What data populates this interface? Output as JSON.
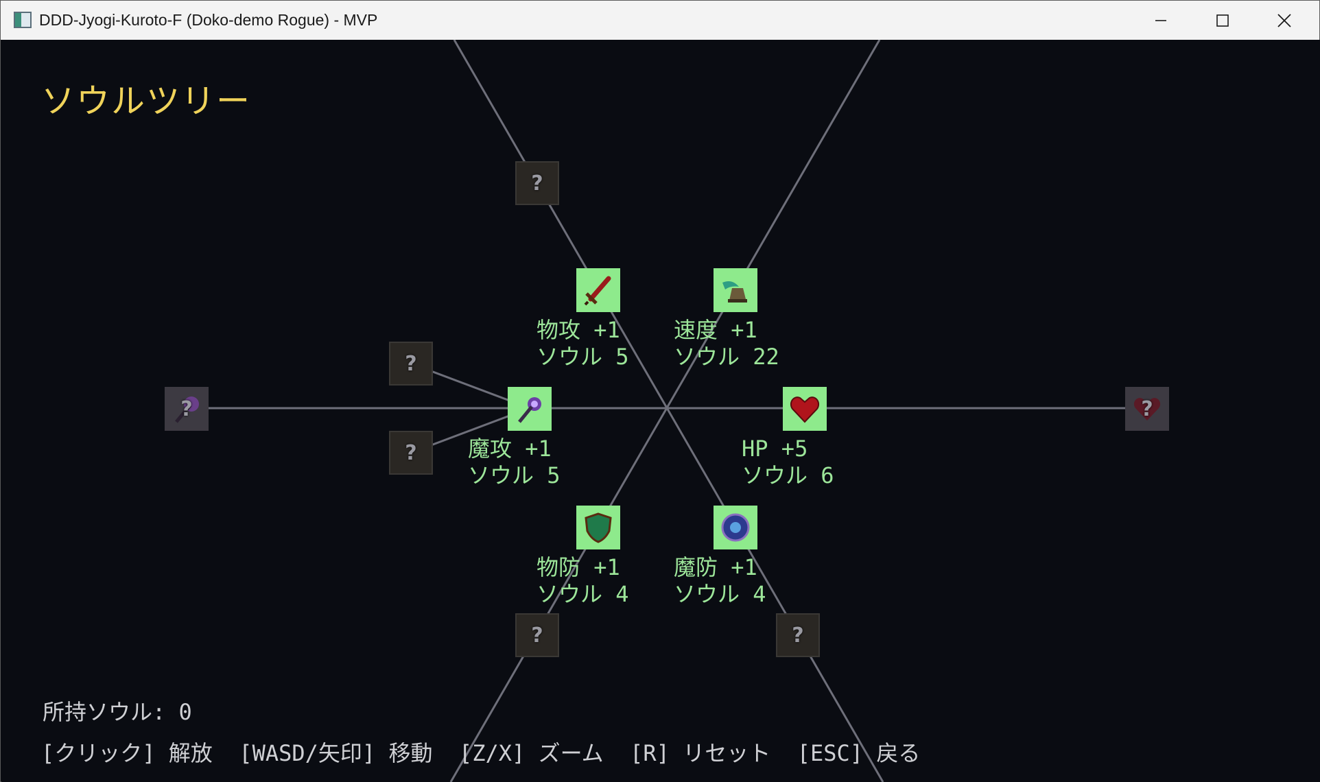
{
  "window": {
    "title": "DDD-Jyogi-Kuroto-F (Doko-demo Rogue) - MVP",
    "minimize_icon": "minimize-icon",
    "maximize_icon": "maximize-icon",
    "close_icon": "close-icon"
  },
  "screen": {
    "heading": "ソウルツリー",
    "heading_color": "#f0d35a",
    "unlocked_color": "#8eea8c",
    "label_color": "#9de69a"
  },
  "nodes": {
    "phys_atk": {
      "icon": "sword-icon",
      "label1": "物攻 +1",
      "label2": "ソウル 5"
    },
    "speed": {
      "icon": "winged-boot-icon",
      "label1": "速度 +1",
      "label2": "ソウル 22"
    },
    "mag_atk": {
      "icon": "magic-staff-icon",
      "label1": "魔攻 +1",
      "label2": "ソウル 5"
    },
    "hp": {
      "icon": "heart-icon",
      "label1": "HP +5",
      "label2": "ソウル 6"
    },
    "phys_def": {
      "icon": "shield-icon",
      "label1": "物防 +1",
      "label2": "ソウル 4"
    },
    "mag_def": {
      "icon": "magic-crest-icon",
      "label1": "魔防 +1",
      "label2": "ソウル 4"
    },
    "locked_mark": "?"
  },
  "footer": {
    "souls": "所持ソウル: 0",
    "help": "[クリック] 解放  [WASD/矢印] 移動  [Z/X] ズーム  [R] リセット  [ESC] 戻る"
  }
}
